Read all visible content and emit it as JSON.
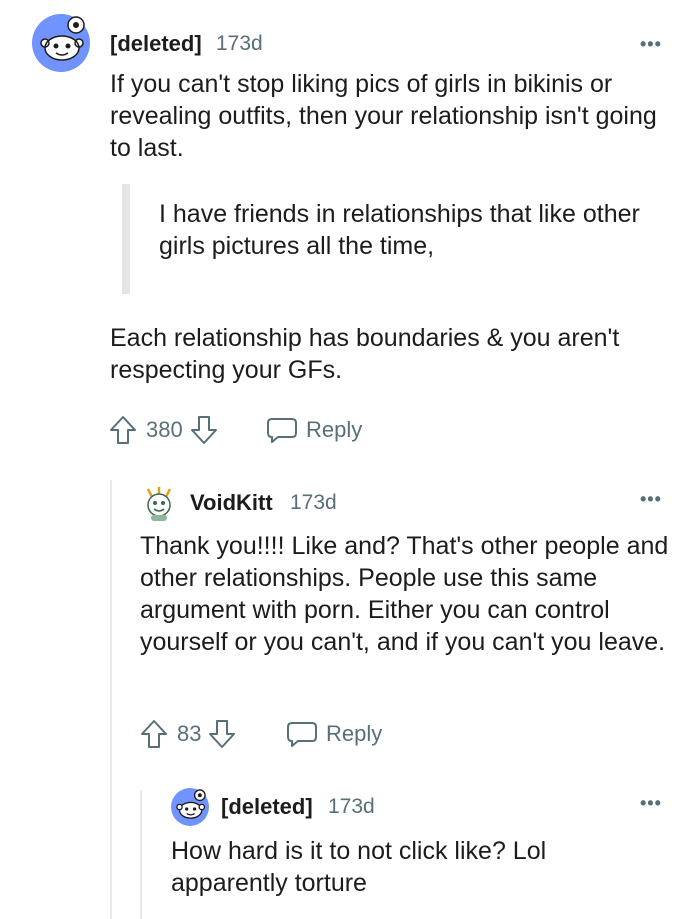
{
  "comments": [
    {
      "author": "[deleted]",
      "age": "173d",
      "more_label": "•••",
      "paragraph1": "If you can't stop liking pics of girls in bikinis or revealing outfits, then your relationship isn't going to last.",
      "quote": "I have friends in relationships that like other girls pictures all the time,",
      "paragraph2": "Each relationship has boundaries & you aren't respecting your GFs.",
      "score": "380",
      "reply_label": "Reply"
    },
    {
      "author": "VoidKitt",
      "age": "173d",
      "more_label": "•••",
      "text": "Thank you!!!! Like and? That's other people and other relationships. People use this same argument with porn. Either you can control yourself or you can't, and if you can't you leave.",
      "score": "83",
      "reply_label": "Reply"
    },
    {
      "author": "[deleted]",
      "age": "173d",
      "more_label": "•••",
      "text": "How hard is it to not click like? Lol apparently torture"
    }
  ],
  "colors": {
    "avatar_blue": "#7193ff",
    "meta_gray": "#576f76",
    "quote_bar": "#e5e5e5",
    "text": "#1c1c1c"
  },
  "icons": [
    "snoo-avatar-icon",
    "voidkitt-avatar-icon",
    "upvote-icon",
    "downvote-icon",
    "comment-reply-icon",
    "more-options-icon"
  ]
}
